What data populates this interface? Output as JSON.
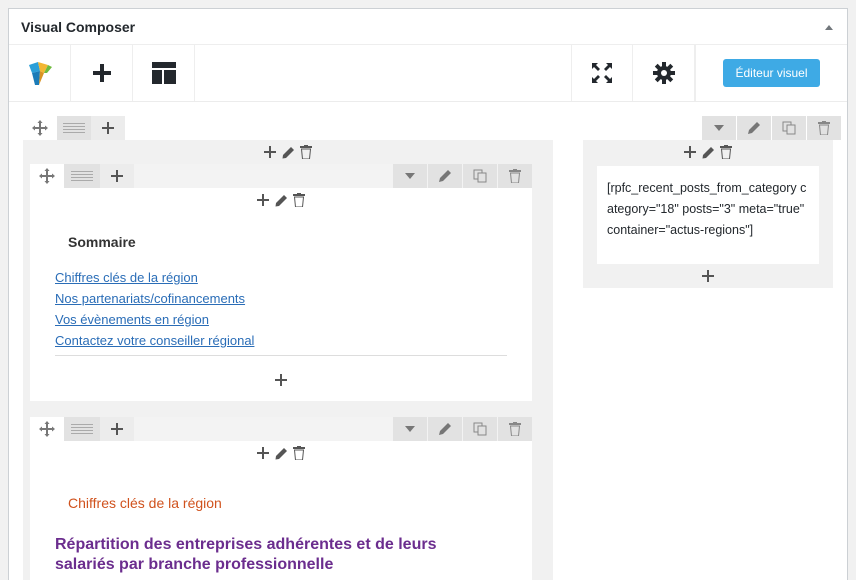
{
  "panel": {
    "title": "Visual Composer"
  },
  "toolbar": {
    "logo_icon": "vc-logo-icon",
    "add_icon": "plus-icon",
    "templates_icon": "layout-icon",
    "fullscreen_icon": "expand-icon",
    "settings_icon": "gear-icon",
    "visual_editor_label": "Éditeur visuel"
  },
  "sommaire": {
    "title": "Sommaire",
    "links": [
      "Chiffres clés de la région",
      "Nos partenariats/cofinancements",
      "Vos évènements en région",
      "Contactez votre conseiller régional"
    ]
  },
  "section2": {
    "heading": "Chiffres clés de la région",
    "title": "Répartition des entreprises adhérentes et de leurs salariés par branche professionnelle"
  },
  "sidebar": {
    "shortcode": "[rpfc_recent_posts_from_category category=\"18\" posts=\"3\" meta=\"true\" container=\"actus-regions\"]"
  },
  "colors": {
    "accent": "#3eaae5",
    "link": "#2a6db7",
    "orange": "#d0521d",
    "purple": "#6b2d8e"
  }
}
